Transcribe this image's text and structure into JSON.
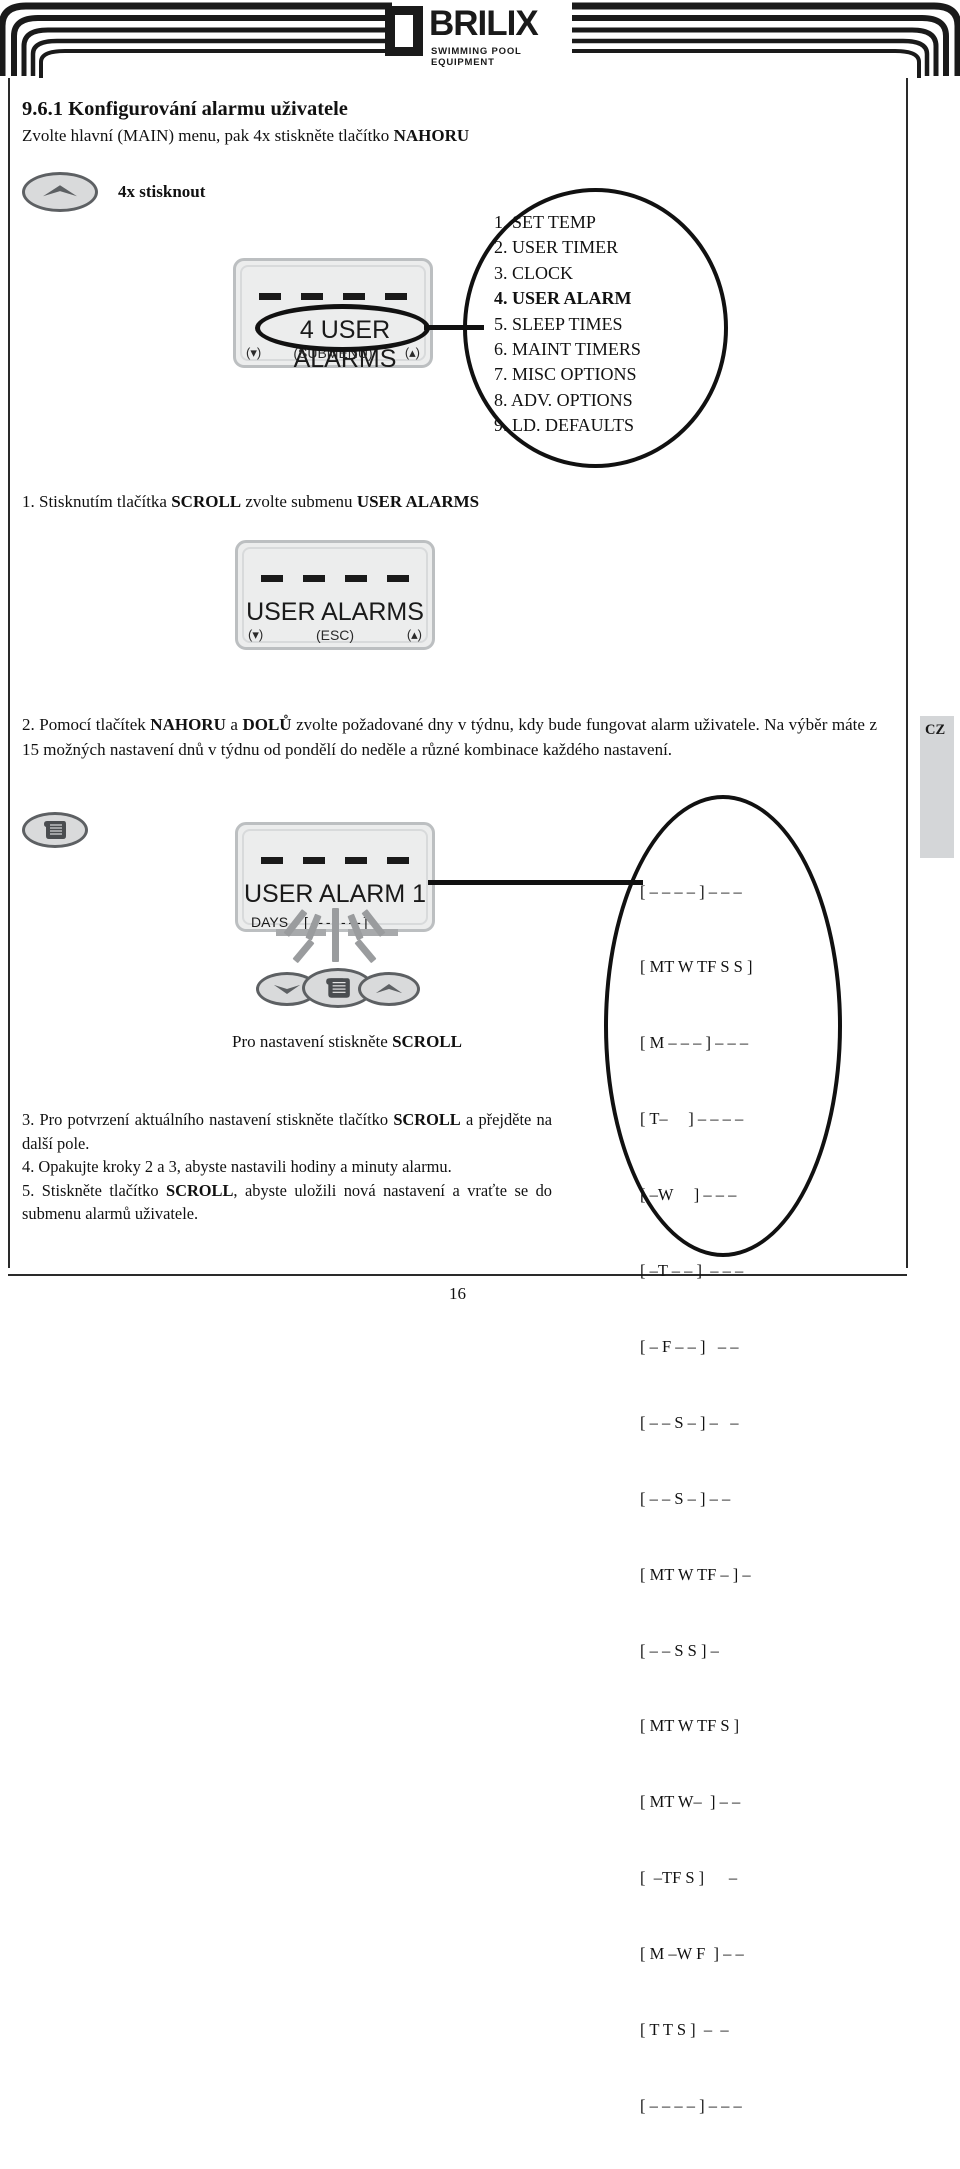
{
  "header": {
    "logo_text": "BRILIX",
    "logo_tagline": "SWIMMING POOL EQUIPMENT",
    "logo_icon": "brilix-square-logo"
  },
  "section": {
    "number_title": "9.6.1 Konfigurování alarmu uživatele",
    "intro_prefix": "Zvolte hlavní (MAIN) menu, pak 4x stiskněte tlačítko ",
    "intro_bold": "NAHORU",
    "press_label": "4x stisknout"
  },
  "lcd1": {
    "prefix": "4",
    "main": "USER ALARMS",
    "sub": "(SUBMENU)",
    "left_corner": "(▾)",
    "right_corner": "(▴)"
  },
  "menu": {
    "items": [
      "1. SET TEMP",
      "2. USER TIMER",
      "3. CLOCK",
      "4. USER ALARM",
      "5. SLEEP TIMES",
      "6. MAINT TIMERS",
      "7. MISC OPTIONS",
      "8. ADV. OPTIONS",
      "9. LD. DEFAULTS"
    ],
    "selected_index": 3
  },
  "step1": {
    "a": "1. Stisknutím tlačítka ",
    "b1": "SCROLL",
    "c": " zvolte submenu  ",
    "b2": "USER ALARMS"
  },
  "lcd2": {
    "main": "USER ALARMS",
    "left_corner": "(▾)",
    "center_corner": "(ESC)",
    "right_corner": "(▴)"
  },
  "step2": {
    "a": "2. Pomocí tlačítek ",
    "b1": "NAHORU",
    "c": " a ",
    "b2": "DOLŮ",
    "d": " zvolte požadované dny v týdnu, kdy bude fungovat alarm uživatele. Na výběr máte z 15 možných nastavení dnů v týdnu od pondělí do neděle a různé kombinace každého nastavení."
  },
  "cz_tab": {
    "label": "CZ"
  },
  "lcd3": {
    "main": "USER ALARM 1",
    "days_label": "DAYS",
    "days_value": "[ - - - - - - - ]"
  },
  "buttons": {
    "down": "down-chevron",
    "scroll": "scroll-list",
    "up": "up-chevron"
  },
  "caption": {
    "a": "Pro nastavení stiskněte ",
    "b": "SCROLL"
  },
  "days_patterns": [
    "[ – – – – ] – – –",
    "[ MT W TF S S ]",
    "[ M – – – ] – – –",
    "[ T–     ] – – – –",
    "[ –W     ] – – –",
    "[ –T – – ]  – – –",
    "[ – F – – ]   – –",
    "[ – – S – ] –   –",
    "[ – – S – ] – –",
    "[ MT W TF – ] –",
    "[ – – S S ] –",
    "[ MT W TF S ]",
    "[ MT W–  ] – –",
    "[  –TF S ]      –",
    "[ M –W F  ] – –",
    "[ T T S ]  –  –",
    "[ – – – – ] – – –"
  ],
  "steps": {
    "s3a": "3. Pro potvrzení aktuálního nastavení stiskněte tlačítko ",
    "s3b": "SCROLL",
    "s3c": " a přejděte na další pole.",
    "s4": "4. Opakujte kroky 2 a 3, abyste nastavili hodiny a minuty alarmu.",
    "s5a": "5. Stiskněte tlačítko ",
    "s5b": "SCROLL",
    "s5c": ", abyste uložili nová nastavení a vraťte se do submenu alarmů uživatele."
  },
  "footer": {
    "page_number": "16"
  }
}
